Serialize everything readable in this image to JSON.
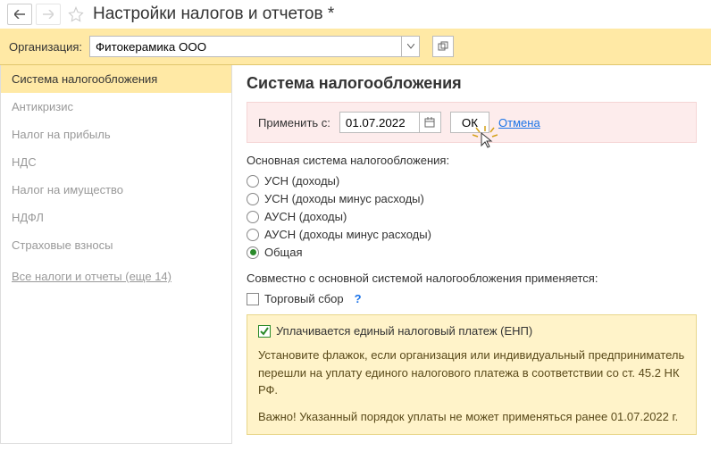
{
  "header": {
    "title": "Настройки налогов и отчетов *"
  },
  "org": {
    "label": "Организация:",
    "value": "Фитокерамика ООО"
  },
  "sidebar": {
    "items": [
      "Система налогообложения",
      "Антикризис",
      "Налог на прибыль",
      "НДС",
      "Налог на имущество",
      "НДФЛ",
      "Страховые взносы"
    ],
    "all_link": "Все налоги и отчеты (еще 14)"
  },
  "main": {
    "title": "Система налогообложения",
    "apply": {
      "label": "Применить с:",
      "date": "01.07.2022",
      "ok": "ОК",
      "cancel": "Отмена"
    },
    "system_label": "Основная система налогообложения:",
    "options": [
      "УСН (доходы)",
      "УСН (доходы минус расходы)",
      "АУСН (доходы)",
      "АУСН (доходы минус расходы)",
      "Общая"
    ],
    "selected": 4,
    "combined_label": "Совместно с основной системой налогообложения применяется:",
    "trade_fee": "Торговый сбор",
    "enp": {
      "label": "Уплачивается единый налоговый платеж (ЕНП)",
      "checked": true,
      "help1": "Установите флажок, если организация или индивидуальный предприниматель перешли на уплату единого налогового платежа в соответствии со ст. 45.2 НК РФ.",
      "help2": "Важно! Указанный порядок уплаты не может применяться ранее 01.07.2022 г."
    }
  }
}
